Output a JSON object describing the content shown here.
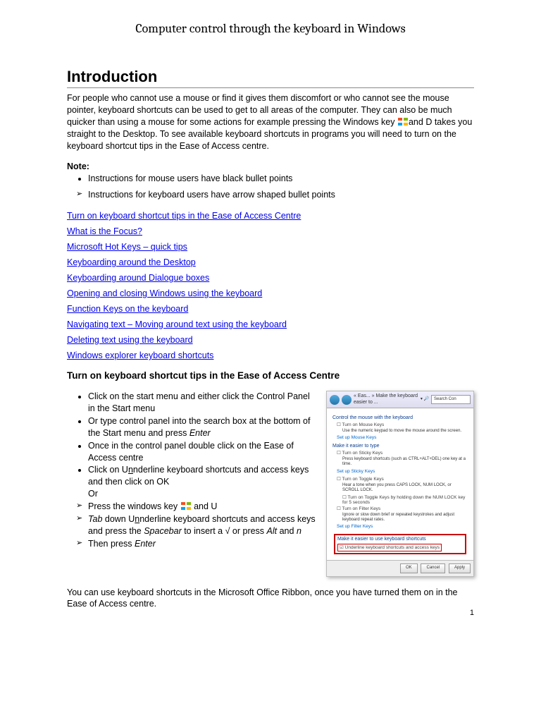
{
  "title": "Computer control through the keyboard in Windows",
  "heading_intro": "Introduction",
  "intro_before_icon": "For people who cannot use a mouse or find it gives them discomfort or who cannot see the mouse pointer, keyboard shortcuts can be used to get to all areas of the computer. They can also be much quicker than using a mouse for some actions for example pressing the Windows key ",
  "intro_after_icon": "and D takes you straight to the Desktop. To see available keyboard shortcuts in programs you will need to turn on the keyboard shortcut tips in the Ease of Access centre.",
  "note_label": "Note:",
  "note_bullet": "Instructions for mouse users have black bullet points",
  "note_arrow": "Instructions for keyboard users have arrow shaped bullet points",
  "links": [
    "Turn on keyboard shortcut tips in the Ease of Access Centre",
    "What is the Focus?",
    "Microsoft Hot Keys – quick tips",
    "Keyboarding around the Desktop",
    "Keyboarding around Dialogue boxes",
    "Opening and closing Windows using the keyboard",
    "Function Keys on the keyboard",
    "Navigating text – Moving around text using the keyboard",
    "Deleting text using the keyboard",
    "Windows explorer keyboard shortcuts"
  ],
  "subsection_heading": "Turn on keyboard shortcut tips in the Ease of Access Centre",
  "steps": {
    "s1": "Click on the start menu and either click  the Control Panel in the Start menu",
    "s2_a": "Or type control panel into the search box at the bottom of the Start menu and press ",
    "s2_b": "Enter",
    "s3": "Once in the control panel double click on the Ease of Access centre",
    "s4_a": "Click on U",
    "s4_b": "nderline  keyboard shortcuts and access keys and then click on OK",
    "s5": "Or",
    "s6_a": "Press the windows key ",
    "s6_b": " and U",
    "s7_a": "Tab",
    "s7_b": " down U",
    "s7_c": "nderline  keyboard shortcuts and access keys and press the  ",
    "s7_d": "Spacebar",
    "s7_e": " to insert a √ or press ",
    "s7_f": "Alt",
    "s7_g": " and ",
    "s7_h": "n",
    "s8_a": "Then press ",
    "s8_b": "Enter"
  },
  "closing_text": "You can use keyboard shortcuts in the Microsoft Office Ribbon, once you have turned them on in the Ease of Access centre.",
  "page_number": "1",
  "screenshot": {
    "breadcrumb": "« Eas... » Make the keyboard easier to ...",
    "search_label": "Search Con",
    "g1_h": "Control the mouse with the keyboard",
    "g1_c": "Turn on Mouse Keys",
    "g1_d": "Use the numeric keypad to move the mouse around the screen.",
    "g1_l": "Set up Mouse Keys",
    "g2_h": "Make it easier to type",
    "g2_c": "Turn on Sticky Keys",
    "g2_d": "Press keyboard shortcuts (such as CTRL+ALT+DEL) one key at a time.",
    "g2_l": "Set up Sticky Keys",
    "g3_c": "Turn on Toggle Keys",
    "g3_d1": "Hear a tone when you press CAPS LOCK, NUM LOCK, or SCROLL LOCK.",
    "g3_d2": "Turn on Toggle Keys by holding down the NUM LOCK key for 5 seconds",
    "g4_c": "Turn on Filter Keys",
    "g4_d": "Ignore or slow down brief or repeated keystrokes and adjust keyboard repeat rates.",
    "g4_l": "Set up Filter Keys",
    "red_h": "Make it easier to use keyboard shortcuts",
    "red_c": "Underline keyboard shortcuts and access keys",
    "btn_ok": "OK",
    "btn_cancel": "Cancel",
    "btn_apply": "Apply"
  }
}
